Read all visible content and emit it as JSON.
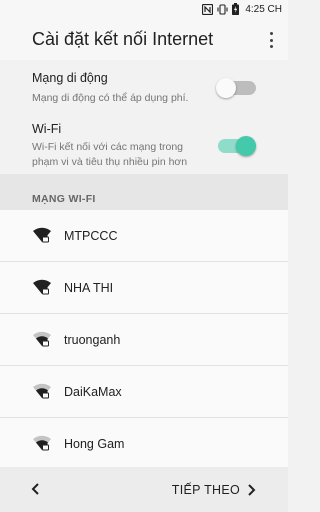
{
  "status_bar": {
    "time": "4:25 CH",
    "icons": [
      "nfc-icon",
      "vibrate-icon",
      "battery-charging-icon"
    ]
  },
  "app_bar": {
    "title": "Cài đặt kết nối Internet",
    "menu_icon": "overflow-menu-icon"
  },
  "settings": {
    "mobile": {
      "title": "Mạng di động",
      "subtitle": "Mạng di động có thể áp dụng phí.",
      "enabled": false
    },
    "wifi": {
      "title": "Wi-Fi",
      "subtitle": "Wi-Fi kết nối với các mạng trong phạm vi và tiêu thụ nhiều pin hơn",
      "enabled": true
    }
  },
  "wifi_section": {
    "header": "MẠNG WI-FI",
    "networks": [
      {
        "name": "MTPCCC",
        "strength": "strong",
        "secured": true
      },
      {
        "name": "NHA THI",
        "strength": "strong",
        "secured": true
      },
      {
        "name": "truonganh",
        "strength": "medium",
        "secured": true
      },
      {
        "name": "DaiKaMax",
        "strength": "medium",
        "secured": true
      },
      {
        "name": "Hong Gam",
        "strength": "medium",
        "secured": true
      }
    ]
  },
  "bottom_bar": {
    "back_icon": "chevron-left-icon",
    "next_label": "TIẾP THEO",
    "next_icon": "chevron-right-icon"
  },
  "colors": {
    "accent": "#45c9ab",
    "accent_track": "#8edcc9",
    "background": "#f2f2f2",
    "section_header_bg": "#e6e6e6"
  }
}
